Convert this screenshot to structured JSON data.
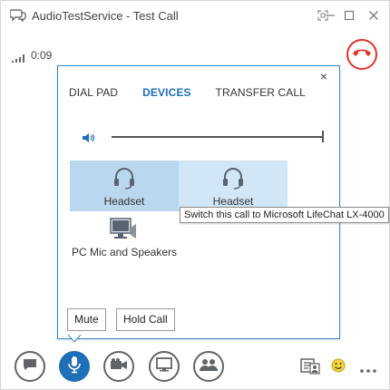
{
  "window": {
    "title": "AudioTestService - Test Call",
    "app_icon": "chat-bubbles-icon",
    "controls": [
      "focus-icon",
      "minimize-icon",
      "maximize-icon",
      "close-icon"
    ]
  },
  "call": {
    "duration": "0:09",
    "signal_icon": "signal-bars-icon",
    "hangup_icon": "hang-up-icon",
    "hangup_color": "#e0332b"
  },
  "popup": {
    "close_label": "×",
    "tabs": [
      {
        "label": "DIAL PAD",
        "active": false
      },
      {
        "label": "DEVICES",
        "active": true
      },
      {
        "label": "TRANSFER CALL",
        "active": false
      }
    ],
    "volume_icon": "speaker-icon",
    "devices": [
      {
        "label": "Headset",
        "icon": "headset-icon",
        "state": "selected"
      },
      {
        "label": "Headset",
        "icon": "headset-icon",
        "state": "hover"
      },
      {
        "label": "PC Mic and Speakers",
        "icon": "monitor-speaker-icon",
        "state": "normal"
      }
    ],
    "tooltip": "Switch this call to Microsoft LifeChat LX-4000",
    "mute_label": "Mute",
    "hold_label": "Hold Call"
  },
  "toolbar": {
    "buttons": [
      {
        "icon": "chat-icon",
        "active": false
      },
      {
        "icon": "microphone-icon",
        "active": true
      },
      {
        "icon": "video-camera-icon",
        "active": false
      },
      {
        "icon": "present-screen-icon",
        "active": false
      },
      {
        "icon": "participants-icon",
        "active": false
      }
    ],
    "right": [
      "contact-card-icon",
      "emoji-icon",
      "more-options-icon"
    ]
  },
  "colors": {
    "accent": "#1e6fb8",
    "selected_device": "#b9d7ee",
    "hover_device": "#d1e6f6",
    "popup_border": "#2c87cf"
  }
}
